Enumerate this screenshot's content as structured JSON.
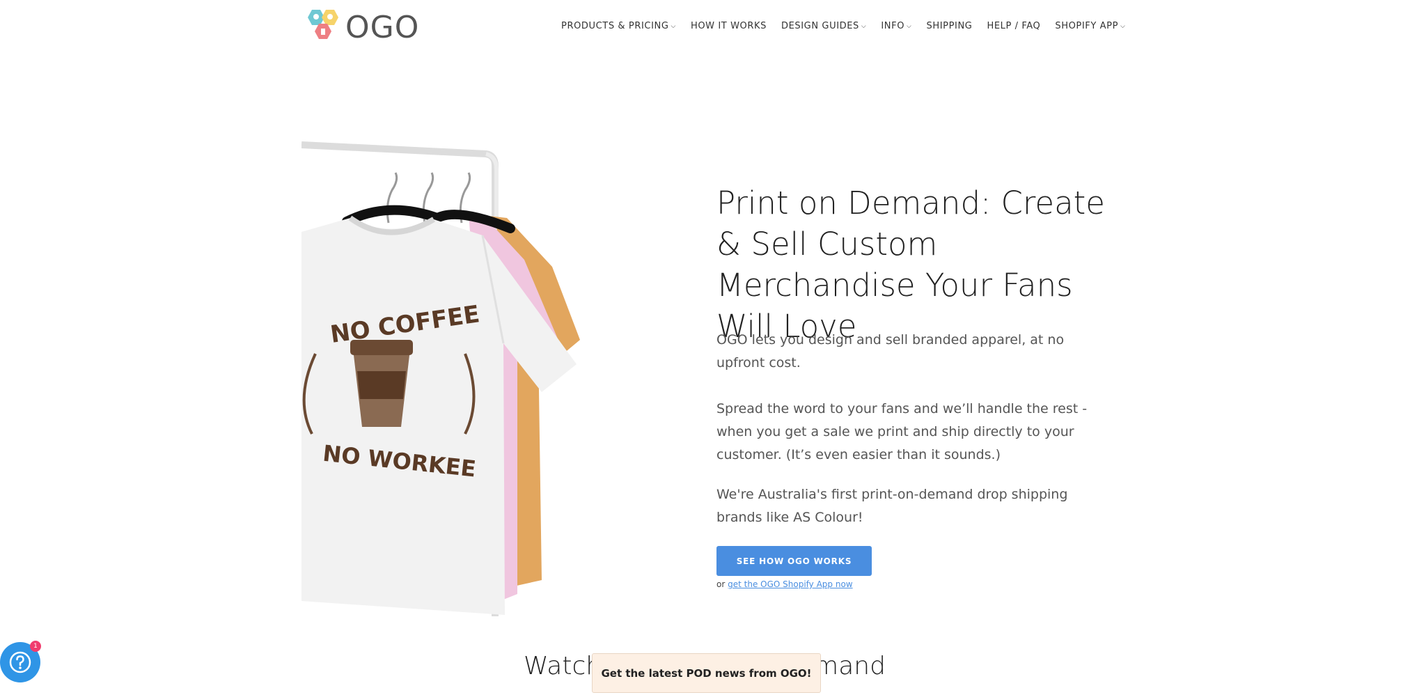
{
  "brand": {
    "name": "OGO"
  },
  "nav": {
    "items": [
      {
        "label": "PRODUCTS & PRICING",
        "has_dropdown": true
      },
      {
        "label": "HOW IT WORKS",
        "has_dropdown": false
      },
      {
        "label": "DESIGN GUIDES",
        "has_dropdown": true
      },
      {
        "label": "INFO",
        "has_dropdown": true
      },
      {
        "label": "SHIPPING",
        "has_dropdown": false
      },
      {
        "label": "HELP / FAQ",
        "has_dropdown": false
      },
      {
        "label": "SHOPIFY APP",
        "has_dropdown": true
      }
    ]
  },
  "hero": {
    "image": {
      "shirt_text_top": "NO COFFEE",
      "shirt_text_bottom": "NO WORKEE",
      "shirt_colors": [
        "#f2f2f2",
        "#f0c6df",
        "#e2a65e"
      ]
    },
    "headline": "Print on Demand: Create & Sell Custom Merchandise Your Fans Will Love",
    "paragraph_1": "OGO lets you design and sell branded apparel, at no upfront cost.",
    "paragraph_2": "Spread the word to your fans and we’ll handle the rest - when you get a sale we print and ship directly to your customer. (It’s even easier than it sounds.)",
    "paragraph_3": "We're Australia's first print-on-demand drop shipping brands like AS Colour!",
    "cta_label": "SEE HOW OGO WORKS",
    "or_text": "or",
    "shopify_link": "get the OGO Shopify App now"
  },
  "section": {
    "title_left": "Watch",
    "title_right": "emand"
  },
  "popup": {
    "label": "Get the latest POD news from OGO!"
  },
  "help_widget": {
    "icon": "question-icon",
    "badge": "1"
  },
  "colors": {
    "accent": "#4a8ee0",
    "help_blue": "#2f95e6",
    "badge_pink": "#f03d6e",
    "popup_bg": "#fdf0e4"
  }
}
